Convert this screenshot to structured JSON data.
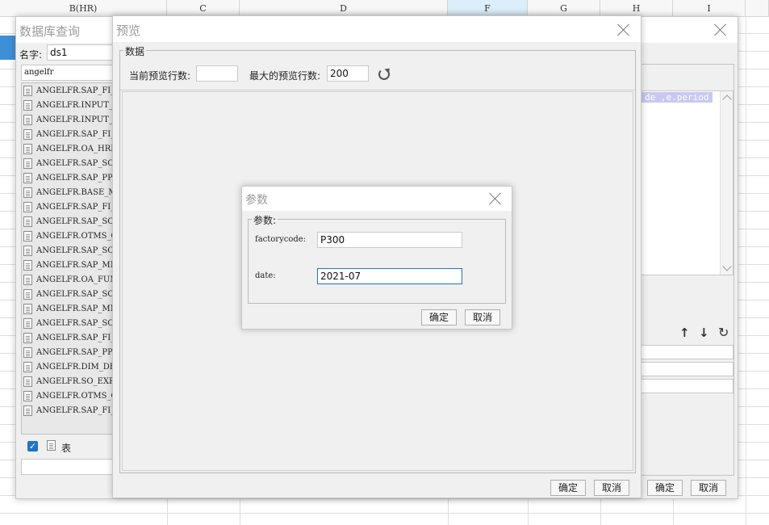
{
  "spreadsheet": {
    "columns": [
      "B(HR)",
      "C",
      "D",
      "F",
      "G",
      "H",
      "I"
    ]
  },
  "query_window": {
    "title": "数据库查询",
    "name_label": "名字:",
    "name_value": "ds1",
    "schema_value": "angelfr",
    "tables": [
      "ANGELFR.SAP_FI_F",
      "ANGELFR.INPUT_SA",
      "ANGELFR.INPUT_PI",
      "ANGELFR.SAP_FI_C",
      "ANGELFR.OA_HRM_S",
      "ANGELFR.SAP_SO_F",
      "ANGELFR.SAP_PP_F",
      "ANGELFR.BASE_MAT",
      "ANGELFR.SAP_FI_C",
      "ANGELFR.SAP_SO_F",
      "ANGELFR.OTMS_ORI",
      "ANGELFR.SAP_SO_I",
      "ANGELFR.SAP_MM_I",
      "ANGELFR.OA_FUND_",
      "ANGELFR.SAP_SO_F",
      "ANGELFR.SAP_MM_I",
      "ANGELFR.SAP_SO_C",
      "ANGELFR.SAP_FI_V",
      "ANGELFR.SAP_PP_C",
      "ANGELFR.DIM_DEVI",
      "ANGELFR.SO_EXPEN",
      "ANGELFR.OTMS_ORI",
      "ANGELFR.SAP_FI_F"
    ],
    "table_checkbox_label": "表",
    "sql_snippet": "de ,e.period",
    "ok_label": "确定",
    "cancel_label": "取消"
  },
  "preview_window": {
    "title": "预览",
    "group_label": "数据",
    "current_rows_label": "当前预览行数:",
    "current_rows_value": "",
    "max_rows_label": "最大的预览行数:",
    "max_rows_value": "200",
    "ok_label": "确定",
    "cancel_label": "取消"
  },
  "param_dialog": {
    "title": "参数",
    "group_label": "参数:",
    "params": [
      {
        "name": "factorycode:",
        "value": "P300"
      },
      {
        "name": "date:",
        "value": "2021-07"
      }
    ],
    "ok_label": "确定",
    "cancel_label": "取消"
  },
  "colors": {
    "accent": "#1e74c8",
    "selected_column": "#dbeef9",
    "sql_highlight": "#c8c8f0"
  }
}
